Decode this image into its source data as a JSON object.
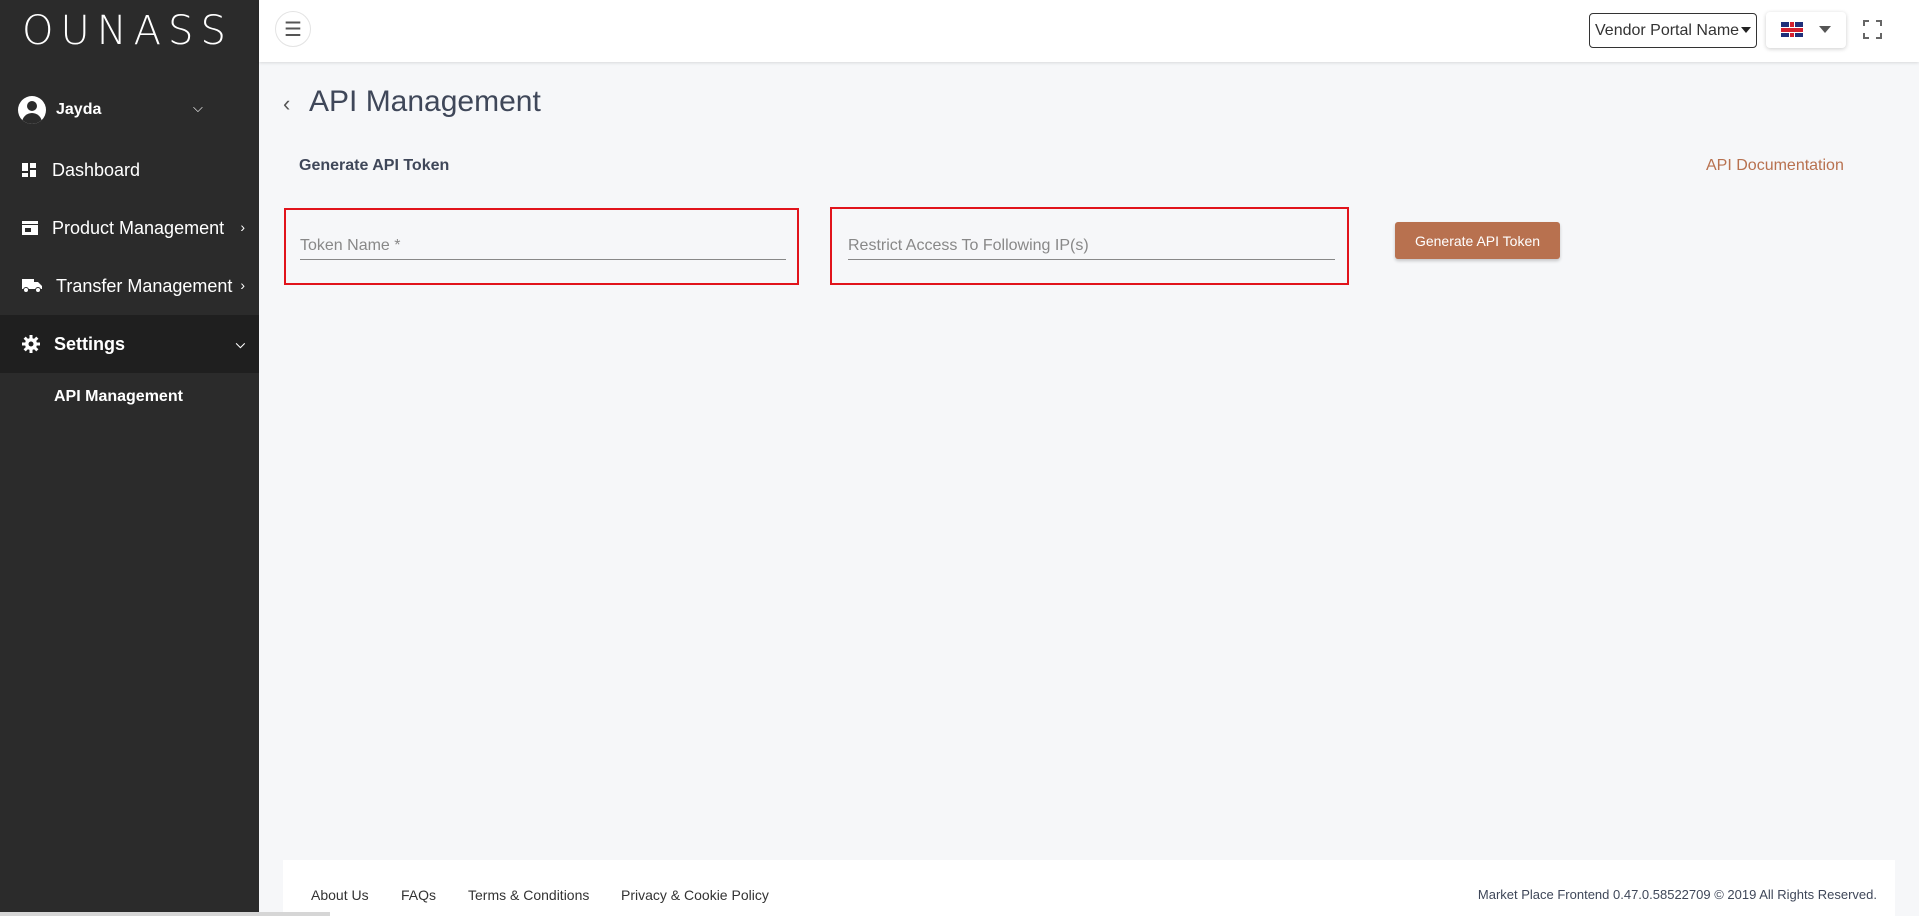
{
  "brand": {
    "logo_text": "OUNASS"
  },
  "user": {
    "name": "Jayda"
  },
  "sidebar": {
    "items": [
      {
        "label": "Dashboard",
        "icon": "dashboard-icon",
        "has_arrow": false
      },
      {
        "label": "Product Management",
        "icon": "store-icon",
        "has_arrow": true
      },
      {
        "label": "Transfer Management",
        "icon": "truck-icon",
        "has_arrow": true
      },
      {
        "label": "Settings",
        "icon": "gear-icon",
        "expanded": true
      }
    ],
    "sub_items": [
      {
        "label": "API Management"
      }
    ]
  },
  "topbar": {
    "vendor_select": "Vendor Portal Name",
    "language_flag": "uk-flag-icon"
  },
  "main": {
    "title": "API Management",
    "section_title": "Generate API Token",
    "doc_link": "API Documentation",
    "token_name_placeholder": "Token Name *",
    "ip_placeholder": "Restrict Access To Following IP(s)",
    "generate_button": "Generate API Token"
  },
  "footer": {
    "links": [
      "About Us",
      "FAQs",
      "Terms & Conditions",
      "Privacy & Cookie Policy"
    ],
    "copyright": "Market Place Frontend 0.47.0.58522709 © 2019 All Rights Reserved."
  },
  "colors": {
    "sidebar_bg": "#2b2b2b",
    "accent": "#b8714f",
    "highlight_border": "#e1141c",
    "title_text": "#3f4759"
  }
}
